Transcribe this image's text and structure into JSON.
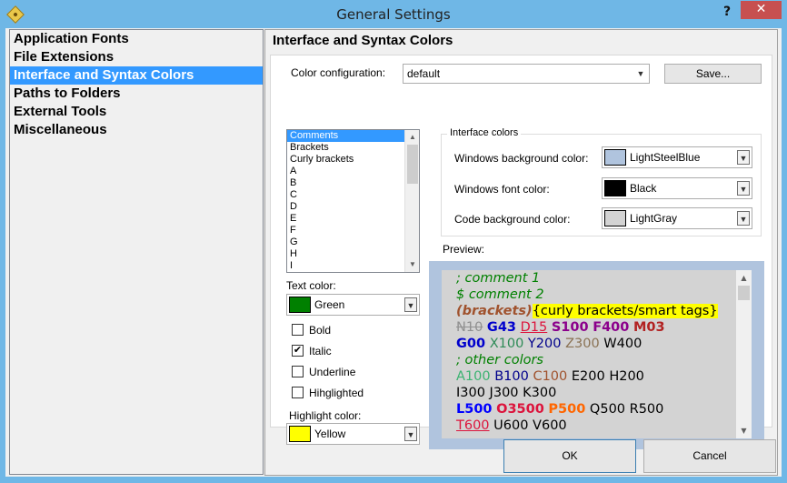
{
  "window": {
    "title": "General Settings",
    "help_label": "?",
    "close_label": "✕"
  },
  "nav": {
    "items": [
      {
        "label": "Application Fonts",
        "selected": false
      },
      {
        "label": "File Extensions",
        "selected": false
      },
      {
        "label": "Interface and Syntax Colors",
        "selected": true
      },
      {
        "label": "Paths to Folders",
        "selected": false
      },
      {
        "label": "External Tools",
        "selected": false
      },
      {
        "label": "Miscellaneous",
        "selected": false
      }
    ]
  },
  "section": {
    "title": "Interface and Syntax Colors"
  },
  "color_config": {
    "label": "Color configuration:",
    "value": "default",
    "save_label": "Save..."
  },
  "element_list": {
    "items": [
      "Comments",
      "Brackets",
      "Curly brackets",
      "A",
      "B",
      "C",
      "D",
      "E",
      "F",
      "G",
      "H",
      "I"
    ],
    "selected": "Comments",
    "scroll_fraction": 0.35
  },
  "text_color": {
    "label": "Text color:",
    "value": "Green",
    "color": "#008000"
  },
  "styles": {
    "bold": {
      "label": "Bold",
      "checked": false
    },
    "italic": {
      "label": "Italic",
      "checked": true
    },
    "underline": {
      "label": "Underline",
      "checked": false
    },
    "highlighted": {
      "label": "Hihglighted",
      "checked": false
    }
  },
  "highlight_color": {
    "label": "Highlight color:",
    "value": "Yellow",
    "color": "#ffff00"
  },
  "interface_colors": {
    "title": "Interface colors",
    "window_bg": {
      "label": "Windows background color:",
      "value": "LightSteelBlue",
      "color": "#b0c4de"
    },
    "window_font": {
      "label": "Windows font color:",
      "value": "Black",
      "color": "#000000"
    },
    "code_bg": {
      "label": "Code background color:",
      "value": "LightGray",
      "color": "#d3d3d3"
    }
  },
  "preview": {
    "label": "Preview:",
    "lines": [
      [
        {
          "text": "; comment 1",
          "color": "#008000",
          "style": "i"
        }
      ],
      [
        {
          "text": "$ comment 2",
          "color": "#008000",
          "style": "i"
        }
      ],
      [
        {
          "text": "(brackets)",
          "color": "#a0522d",
          "style": "b i"
        },
        {
          "text": "{curly brackets/smart tags}",
          "color": "#000000",
          "style": "",
          "bg": "#ffff00"
        }
      ],
      [
        {
          "text": "N10",
          "color": "#909090",
          "style": "s"
        },
        {
          "text": " ",
          "color": "#000000",
          "style": ""
        },
        {
          "text": "G43",
          "color": "#0000cd",
          "style": "b"
        },
        {
          "text": " ",
          "color": "#000000",
          "style": ""
        },
        {
          "text": "D15",
          "color": "#dc143c",
          "style": "u"
        },
        {
          "text": " ",
          "color": "#000000",
          "style": ""
        },
        {
          "text": "S100",
          "color": "#8b008b",
          "style": "b"
        },
        {
          "text": " ",
          "color": "#000000",
          "style": ""
        },
        {
          "text": "F400",
          "color": "#8b008b",
          "style": "b"
        },
        {
          "text": " ",
          "color": "#000000",
          "style": ""
        },
        {
          "text": "M03",
          "color": "#b22222",
          "style": "b"
        }
      ],
      [
        {
          "text": "G00",
          "color": "#0000cd",
          "style": "b"
        },
        {
          "text": " X100",
          "color": "#2e8b57",
          "style": ""
        },
        {
          "text": " Y200",
          "color": "#00008b",
          "style": ""
        },
        {
          "text": " Z300",
          "color": "#8b7355",
          "style": ""
        },
        {
          "text": " W400",
          "color": "#000000",
          "style": ""
        }
      ],
      [
        {
          "text": "; other colors",
          "color": "#008000",
          "style": "i"
        }
      ],
      [
        {
          "text": "A100",
          "color": "#3cb371",
          "style": ""
        },
        {
          "text": " B100",
          "color": "#00008b",
          "style": ""
        },
        {
          "text": " C100",
          "color": "#a0522d",
          "style": ""
        },
        {
          "text": " E200 H200",
          "color": "#000000",
          "style": ""
        }
      ],
      [
        {
          "text": "I300 J300 K300",
          "color": "#000000",
          "style": ""
        }
      ],
      [
        {
          "text": "L500",
          "color": "#0000ff",
          "style": "b"
        },
        {
          "text": " ",
          "color": "#000000",
          "style": ""
        },
        {
          "text": "O3500",
          "color": "#dc143c",
          "style": "b"
        },
        {
          "text": " ",
          "color": "#000000",
          "style": ""
        },
        {
          "text": "P500",
          "color": "#ff6600",
          "style": "b"
        },
        {
          "text": " Q500 R500",
          "color": "#000000",
          "style": ""
        }
      ],
      [
        {
          "text": "T600",
          "color": "#dc143c",
          "style": "u"
        },
        {
          "text": " U600 V600",
          "color": "#000000",
          "style": ""
        }
      ]
    ]
  },
  "footer": {
    "ok_label": "OK",
    "cancel_label": "Cancel"
  }
}
